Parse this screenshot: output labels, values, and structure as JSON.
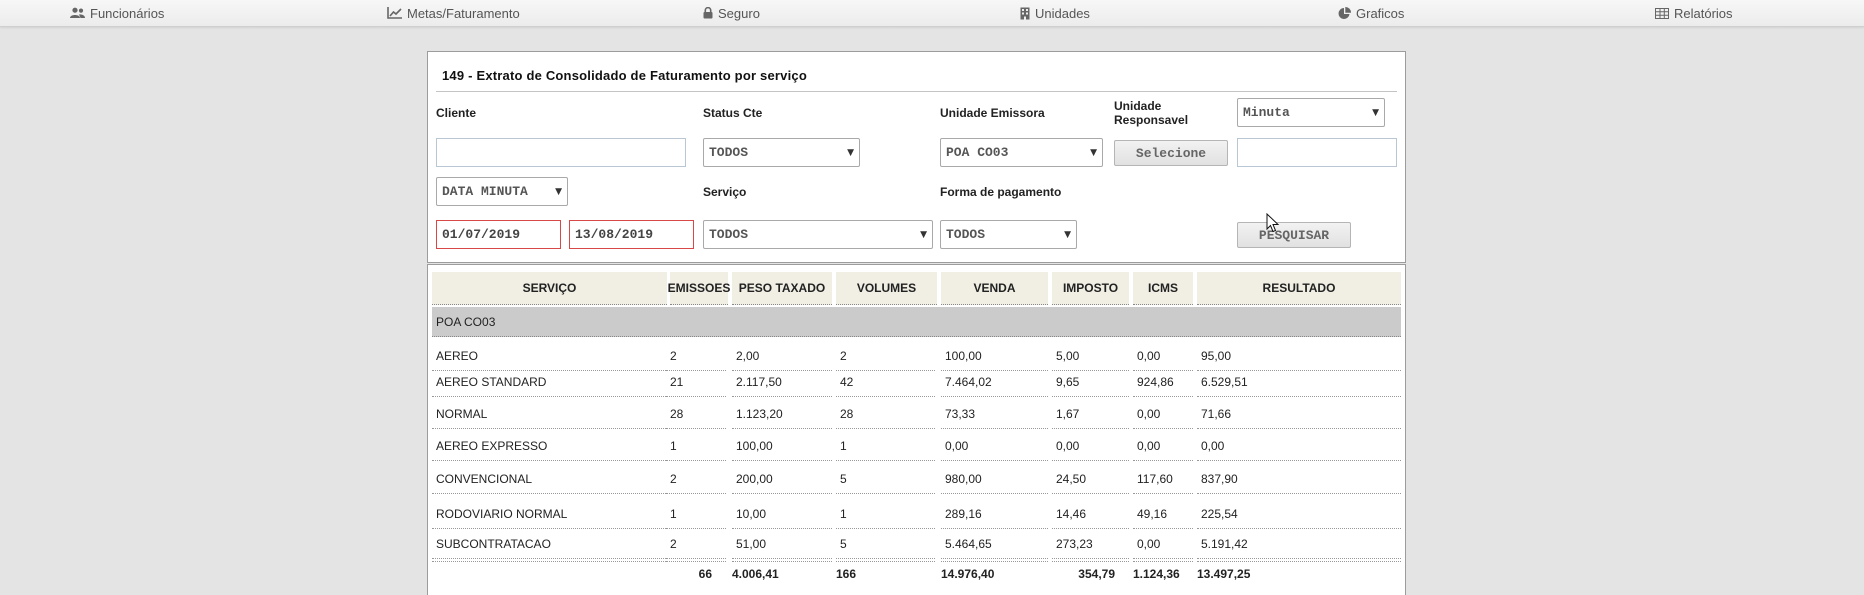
{
  "nav": {
    "items": [
      {
        "label": "Funcionários",
        "icon": "users-icon"
      },
      {
        "label": "Metas/Faturamento",
        "icon": "line-chart-icon"
      },
      {
        "label": "Seguro",
        "icon": "lock-icon"
      },
      {
        "label": "Unidades",
        "icon": "building-icon"
      },
      {
        "label": "Graficos",
        "icon": "pie-chart-icon"
      },
      {
        "label": "Relatórios",
        "icon": "table-icon"
      }
    ]
  },
  "form": {
    "title": "149 - Extrato de Consolidado de Faturamento por serviço",
    "labels": {
      "cliente": "Cliente",
      "status_cte": "Status Cte",
      "unidade_emissora": "Unidade Emissora",
      "unidade_responsavel_1": "Unidade",
      "unidade_responsavel_2": "Responsavel",
      "servico": "Serviço",
      "forma_pagamento": "Forma de pagamento"
    },
    "cliente_value": "",
    "status_cte_value": "TODOS",
    "unidade_emissora_value": "POA CO03",
    "selecione_button": "Selecione",
    "responsavel_type_value": "Minuta",
    "responsavel_value": "",
    "date_type_value": "DATA MINUTA",
    "date_from": "01/07/2019",
    "date_to": "13/08/2019",
    "servico_value": "TODOS",
    "forma_pagamento_value": "TODOS",
    "pesquisar_button": "PESQUISAR"
  },
  "table": {
    "headers": [
      "SERVIÇO",
      "EMISSOES",
      "PESO TAXADO",
      "VOLUMES",
      "VENDA",
      "IMPOSTO",
      "ICMS",
      "RESULTADO"
    ],
    "group": "POA CO03",
    "rows": [
      [
        "AEREO",
        "2",
        "2,00",
        "2",
        "100,00",
        "5,00",
        "0,00",
        "95,00"
      ],
      [
        "AEREO STANDARD",
        "21",
        "2.117,50",
        "42",
        "7.464,02",
        "9,65",
        "924,86",
        "6.529,51"
      ],
      [
        "NORMAL",
        "28",
        "1.123,20",
        "28",
        "73,33",
        "1,67",
        "0,00",
        "71,66"
      ],
      [
        "AEREO EXPRESSO",
        "1",
        "100,00",
        "1",
        "0,00",
        "0,00",
        "0,00",
        "0,00"
      ],
      [
        "CONVENCIONAL",
        "2",
        "200,00",
        "5",
        "980,00",
        "24,50",
        "117,60",
        "837,90"
      ],
      [
        "RODOVIARIO NORMAL",
        "1",
        "10,00",
        "1",
        "289,16",
        "14,46",
        "49,16",
        "225,54"
      ],
      [
        "SUBCONTRATACAO",
        "2",
        "51,00",
        "5",
        "5.464,65",
        "273,23",
        "0,00",
        "5.191,42"
      ]
    ],
    "totals": [
      "",
      "66",
      "4.006,41",
      "166",
      "14.976,40",
      "354,79",
      "1.124,36",
      "13.497,25"
    ]
  }
}
